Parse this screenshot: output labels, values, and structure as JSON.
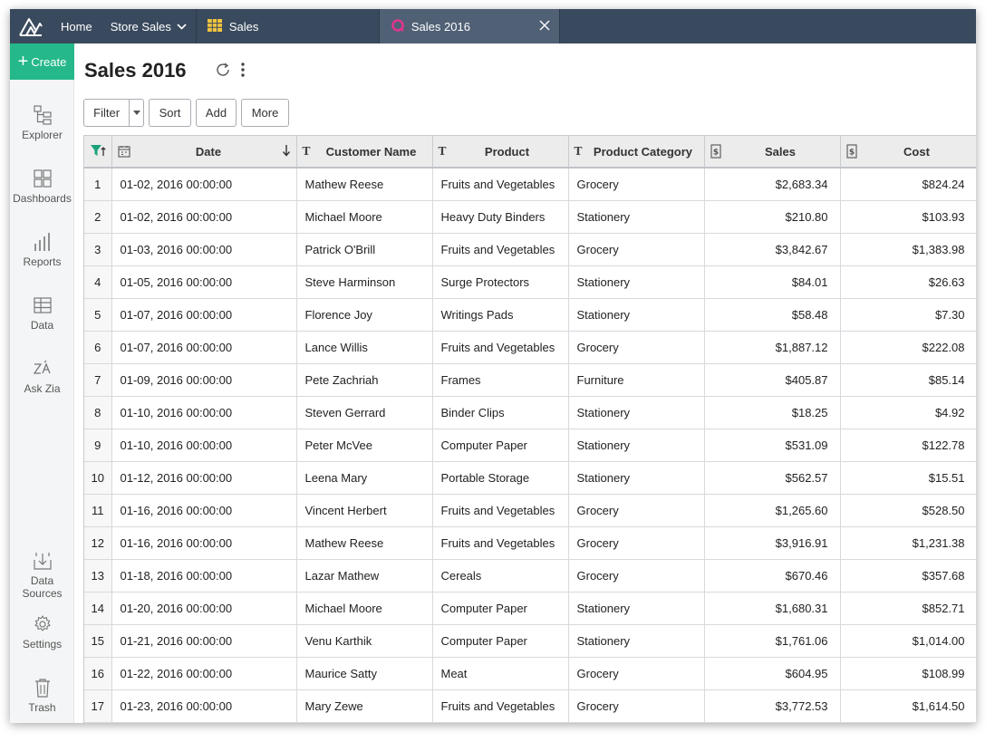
{
  "topbar": {
    "home_label": "Home",
    "workspace_label": "Store Sales",
    "tabs": [
      {
        "label": "Sales",
        "icon": "table-grid-icon"
      },
      {
        "label": "Sales 2016",
        "icon": "query-table-icon",
        "active": true
      }
    ]
  },
  "sidebar": {
    "create_label": "Create",
    "items": [
      {
        "label": "Explorer",
        "icon": "explorer-icon"
      },
      {
        "label": "Dashboards",
        "icon": "dashboards-icon"
      },
      {
        "label": "Reports",
        "icon": "reports-icon"
      },
      {
        "label": "Data",
        "icon": "data-icon"
      },
      {
        "label": "Ask Zia",
        "icon": "ask-zia-icon"
      },
      {
        "label": "Data Sources",
        "icon": "data-sources-icon"
      },
      {
        "label": "Settings",
        "icon": "settings-icon"
      },
      {
        "label": "Trash",
        "icon": "trash-icon"
      }
    ]
  },
  "page": {
    "title": "Sales 2016"
  },
  "toolbar": {
    "filter_label": "Filter",
    "sort_label": "Sort",
    "add_label": "Add",
    "more_label": "More"
  },
  "table": {
    "columns": [
      "Date",
      "Customer Name",
      "Product",
      "Product Category",
      "Sales",
      "Cost"
    ],
    "rows": [
      [
        "1",
        "01-02, 2016 00:00:00",
        "Mathew Reese",
        "Fruits and Vegetables",
        "Grocery",
        "$2,683.34",
        "$824.24"
      ],
      [
        "2",
        "01-02, 2016 00:00:00",
        "Michael Moore",
        "Heavy Duty Binders",
        "Stationery",
        "$210.80",
        "$103.93"
      ],
      [
        "3",
        "01-03, 2016 00:00:00",
        "Patrick O'Brill",
        "Fruits and Vegetables",
        "Grocery",
        "$3,842.67",
        "$1,383.98"
      ],
      [
        "4",
        "01-05, 2016 00:00:00",
        "Steve Harminson",
        "Surge Protectors",
        "Stationery",
        "$84.01",
        "$26.63"
      ],
      [
        "5",
        "01-07, 2016 00:00:00",
        "Florence Joy",
        "Writings Pads",
        "Stationery",
        "$58.48",
        "$7.30"
      ],
      [
        "6",
        "01-07, 2016 00:00:00",
        "Lance Willis",
        "Fruits and Vegetables",
        "Grocery",
        "$1,887.12",
        "$222.08"
      ],
      [
        "7",
        "01-09, 2016 00:00:00",
        "Pete Zachriah",
        "Frames",
        "Furniture",
        "$405.87",
        "$85.14"
      ],
      [
        "8",
        "01-10, 2016 00:00:00",
        "Steven Gerrard",
        "Binder Clips",
        "Stationery",
        "$18.25",
        "$4.92"
      ],
      [
        "9",
        "01-10, 2016 00:00:00",
        "Peter McVee",
        "Computer Paper",
        "Stationery",
        "$531.09",
        "$122.78"
      ],
      [
        "10",
        "01-12, 2016 00:00:00",
        "Leena Mary",
        "Portable Storage",
        "Stationery",
        "$562.57",
        "$15.51"
      ],
      [
        "11",
        "01-16, 2016 00:00:00",
        "Vincent Herbert",
        "Fruits and Vegetables",
        "Grocery",
        "$1,265.60",
        "$528.50"
      ],
      [
        "12",
        "01-16, 2016 00:00:00",
        "Mathew Reese",
        "Fruits and Vegetables",
        "Grocery",
        "$3,916.91",
        "$1,231.38"
      ],
      [
        "13",
        "01-18, 2016 00:00:00",
        "Lazar Mathew",
        "Cereals",
        "Grocery",
        "$670.46",
        "$357.68"
      ],
      [
        "14",
        "01-20, 2016 00:00:00",
        "Michael Moore",
        "Computer Paper",
        "Stationery",
        "$1,680.31",
        "$852.71"
      ],
      [
        "15",
        "01-21, 2016 00:00:00",
        "Venu Karthik",
        "Computer Paper",
        "Stationery",
        "$1,761.06",
        "$1,014.00"
      ],
      [
        "16",
        "01-22, 2016 00:00:00",
        "Maurice Satty",
        "Meat",
        "Grocery",
        "$604.95",
        "$108.99"
      ],
      [
        "17",
        "01-23, 2016 00:00:00",
        "Mary Zewe",
        "Fruits and Vegetables",
        "Grocery",
        "$3,772.53",
        "$1,614.50"
      ]
    ]
  },
  "colors": {
    "topbar": "#3a4a5e",
    "accent_green": "#25b88a",
    "filter_icon_green": "#1aa37a",
    "tab_ring_pink": "#e0358f"
  }
}
